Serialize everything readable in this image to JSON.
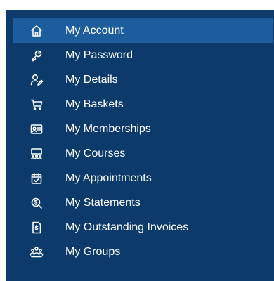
{
  "menu": {
    "items": [
      {
        "label": "My Account",
        "icon": "home-icon",
        "active": true
      },
      {
        "label": "My Password",
        "icon": "key-icon",
        "active": false
      },
      {
        "label": "My Details",
        "icon": "user-edit-icon",
        "active": false
      },
      {
        "label": "My Baskets",
        "icon": "cart-icon",
        "active": false
      },
      {
        "label": "My Memberships",
        "icon": "id-card-icon",
        "active": false
      },
      {
        "label": "My Courses",
        "icon": "classroom-icon",
        "active": false
      },
      {
        "label": "My Appointments",
        "icon": "calendar-check-icon",
        "active": false
      },
      {
        "label": "My Statements",
        "icon": "search-money-icon",
        "active": false
      },
      {
        "label": "My Outstanding Invoices",
        "icon": "invoice-icon",
        "active": false
      },
      {
        "label": "My Groups",
        "icon": "group-icon",
        "active": false
      }
    ]
  },
  "colors": {
    "panel_background": "#0b3a6b",
    "active_background": "#1d5d9b",
    "text": "#ffffff"
  }
}
